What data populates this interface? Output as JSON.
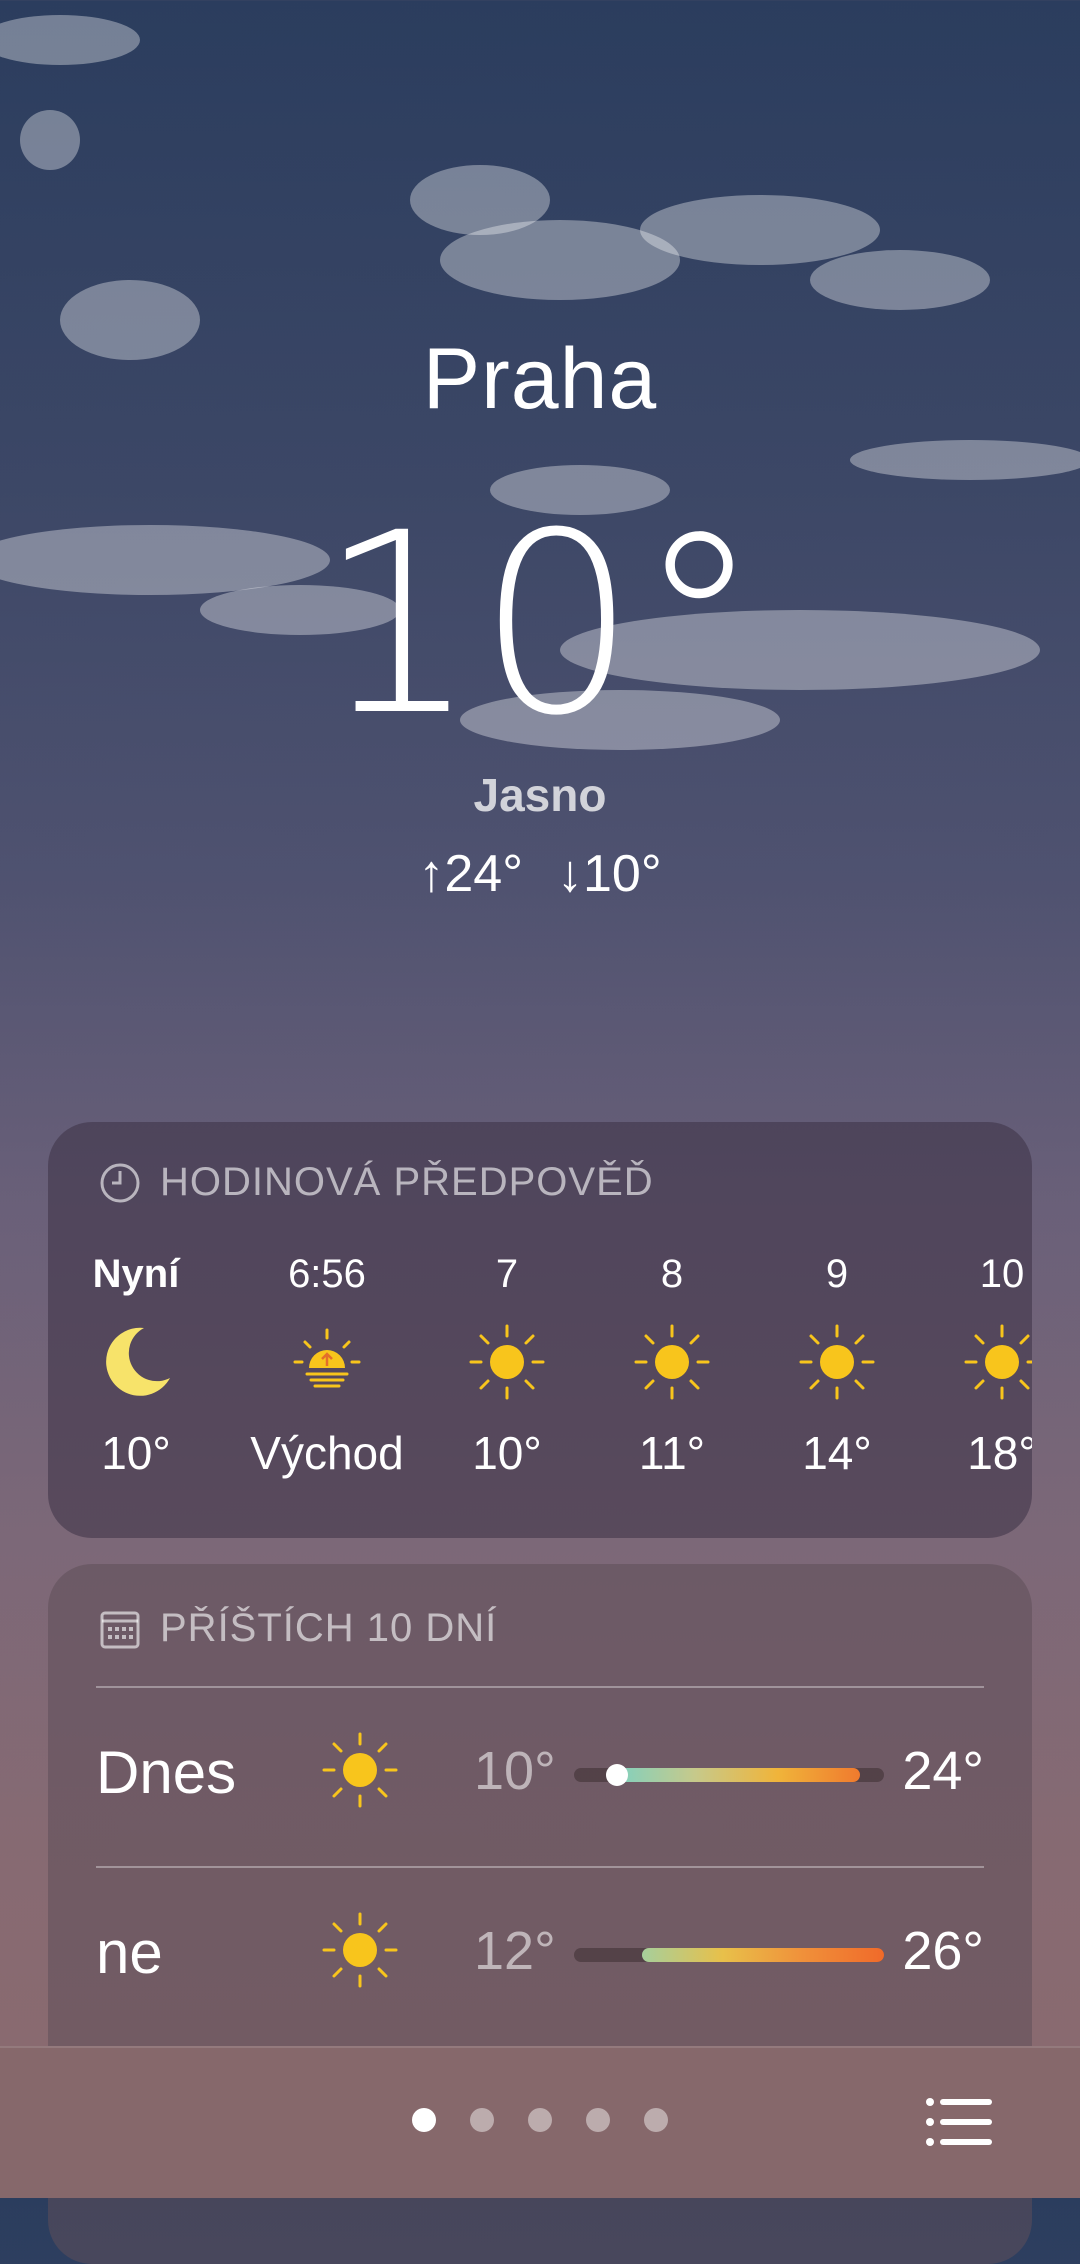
{
  "location": {
    "city": "Praha",
    "temperature": "10°",
    "condition": "Jasno",
    "high": "↑24°",
    "low": "↓10°"
  },
  "hourly": {
    "title": "HODINOVÁ PŘEDPOVĚĎ",
    "items": [
      {
        "time": "Nyní",
        "icon": "moon-icon",
        "temp": "10°"
      },
      {
        "time": "6:56",
        "icon": "sunrise-icon",
        "temp": "Východ"
      },
      {
        "time": "7",
        "icon": "sun-icon",
        "temp": "10°"
      },
      {
        "time": "8",
        "icon": "sun-icon",
        "temp": "11°"
      },
      {
        "time": "9",
        "icon": "sun-icon",
        "temp": "14°"
      },
      {
        "time": "10",
        "icon": "sun-icon",
        "temp": "18°"
      }
    ]
  },
  "daily": {
    "title": "PŘÍŠTÍCH 10 DNÍ",
    "items": [
      {
        "day": "Dnes",
        "icon": "sun-icon",
        "low": "10°",
        "high": "24°"
      },
      {
        "day": "ne",
        "icon": "sun-icon",
        "low": "12°",
        "high": "26°"
      }
    ]
  },
  "pager": {
    "count": 5,
    "active_index": 0
  },
  "colors": {
    "sun": "#f8c51c",
    "moon": "#f7e36a",
    "bar_start": "#7fd1c1",
    "bar_end": "#f07a2e"
  }
}
